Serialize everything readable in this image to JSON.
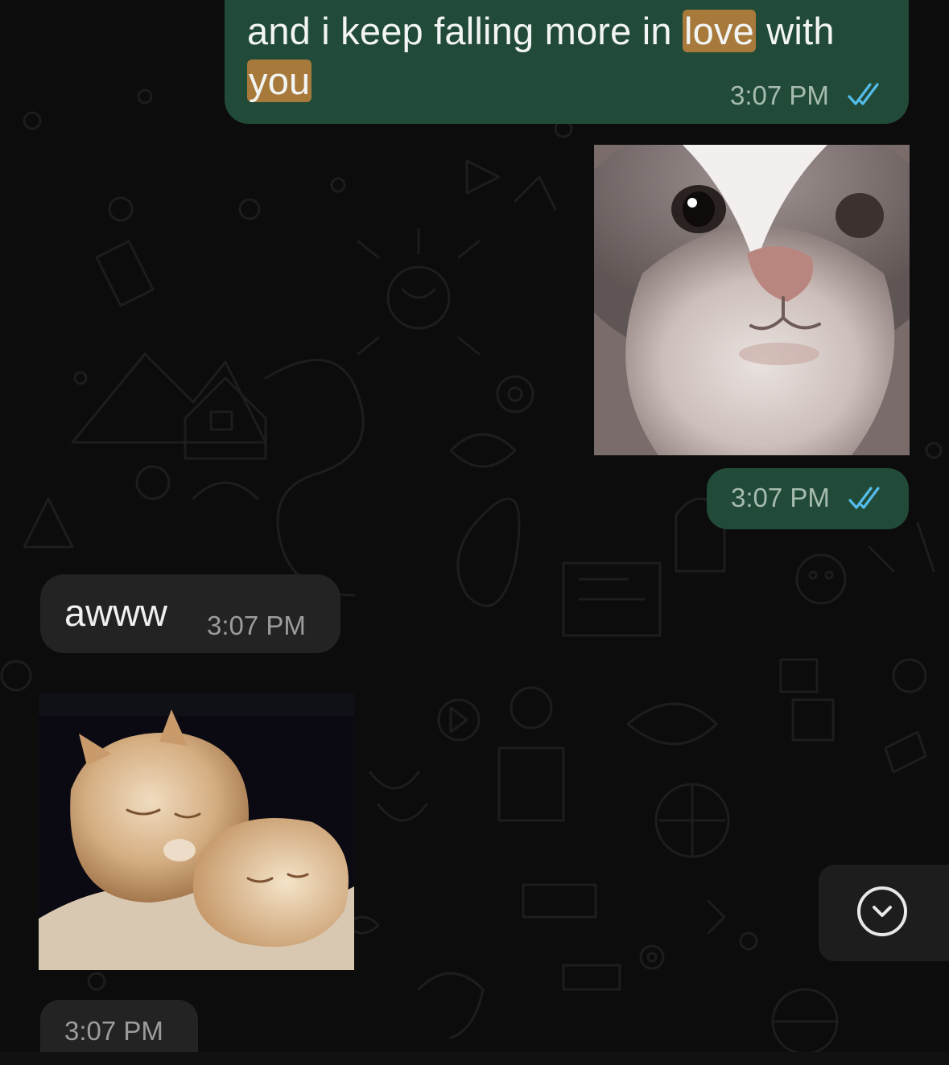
{
  "messages": {
    "outgoing_text": {
      "before": "and i keep falling more in ",
      "highlight_1": "love",
      "middle": " with ",
      "highlight_2": "you",
      "time": "3:07 PM"
    },
    "outgoing_photo": {
      "time": "3:07 PM"
    },
    "incoming_text": {
      "text": "awww",
      "time": "3:07 PM"
    },
    "incoming_photo": {
      "time": "3:07 PM"
    }
  },
  "icons": {
    "read_receipt": "double-check-icon",
    "scroll_down": "chevron-down-circle-icon"
  },
  "colors": {
    "outgoing_bubble": "#224a38",
    "incoming_bubble": "#232323",
    "highlight": "#a77a3c",
    "read_ticks": "#53bdeb",
    "background": "#0c0c0c"
  }
}
